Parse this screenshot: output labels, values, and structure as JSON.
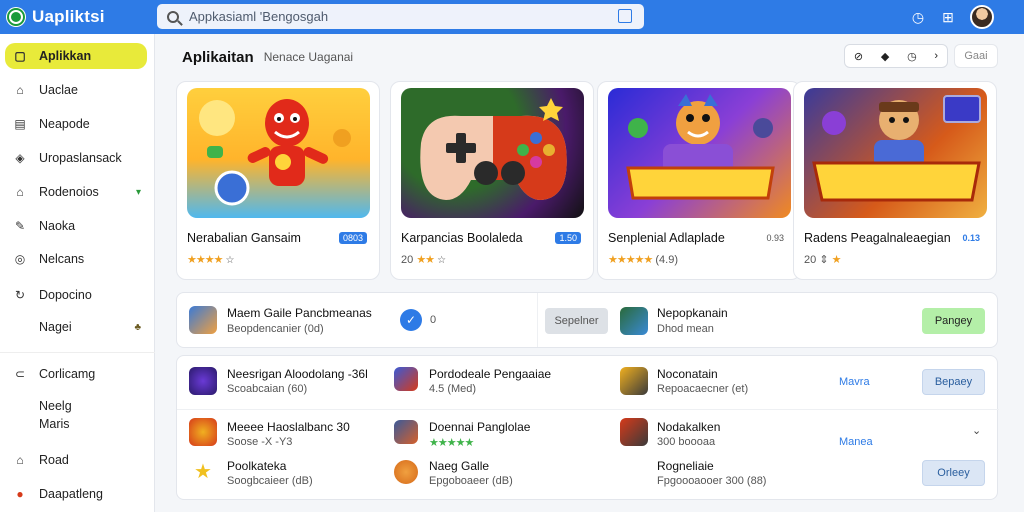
{
  "app": {
    "name": "Uapliktsi",
    "search_placeholder": "Appkasiaml 'Bengosgah"
  },
  "sidebar": {
    "items": [
      {
        "label": "Aplikkan",
        "icon": "grid-icon",
        "trail": ""
      },
      {
        "label": "Uaclae",
        "icon": "home-icon",
        "trail": ""
      },
      {
        "label": "Neapode",
        "icon": "book-icon",
        "trail": ""
      },
      {
        "label": "Uropaslansack",
        "icon": "bookmark-icon",
        "trail": ""
      },
      {
        "label": "Rodenoios",
        "icon": "house-icon",
        "trail": "▾"
      },
      {
        "label": "Naoka",
        "icon": "pen-icon",
        "trail": ""
      },
      {
        "label": "Nelcans",
        "icon": "globe-icon",
        "trail": ""
      },
      {
        "label": "Dopocino",
        "icon": "refresh-icon",
        "trail": ""
      },
      {
        "label": "Nagei",
        "icon": "",
        "trail": "♣"
      },
      {
        "label": "Corlicamg",
        "icon": "cart-icon",
        "trail": ""
      },
      {
        "label": "Neelg",
        "icon": "",
        "trail": ""
      },
      {
        "label": "Maris",
        "icon": "",
        "trail": ""
      },
      {
        "label": "Road",
        "icon": "home-icon",
        "trail": ""
      },
      {
        "label": "Daapatleng",
        "icon": "record-icon",
        "trail": ""
      }
    ]
  },
  "header": {
    "title": "Aplikaitan",
    "subtitle": "Nenace Uaganai",
    "extra": "Gaai"
  },
  "cards": [
    {
      "name": "Nerabalian Gansaim",
      "badge": "0803",
      "meta": "4.7"
    },
    {
      "name": "Karpancias Boolaleda",
      "badge": "1.50",
      "meta": "20"
    },
    {
      "name": "Senplenial Adlaplade",
      "badge": "0.93",
      "meta": "4.9"
    },
    {
      "name": "Radens Peagalnaleaegian",
      "badge": "0.13",
      "meta": "20"
    }
  ],
  "featured": {
    "left": {
      "name": "Maem Gaile Pancbmeanas",
      "meta": "Beopdencanier (0d)",
      "count": "0"
    },
    "middle_button": "Sepelner",
    "right": {
      "name": "Nepopkanain",
      "meta": "Dhod mean"
    },
    "right_button": "Pangey"
  },
  "list_rows": [
    [
      {
        "name": "Neesrigan Aloodolang -36l",
        "meta": "Scoabcaian (60)"
      },
      {
        "name": "Pordodeale Pengaaiae",
        "meta": "4.5 (Med)"
      },
      {
        "name": "Noconatain",
        "meta": "Repoacaecner (et)"
      },
      {
        "link": "Mavra",
        "button": "Bepaey"
      }
    ],
    [
      {
        "name": "Meeee Haoslalbanc 30",
        "meta": "Soose -X -Y3"
      },
      {
        "name": "Doennai Panglolae",
        "meta": "4.6"
      },
      {
        "name": "Nodakalken",
        "meta": "300 boooaa"
      },
      {
        "link": "Manea",
        "button": ""
      }
    ],
    [
      {
        "name": "Poolkateka",
        "meta": "Soogbcaieer (dB)"
      },
      {
        "name": "Naeg Galle",
        "meta": "Epgoboaeer (dB)"
      },
      {
        "name": "Rogneliaie",
        "meta": "Fpgoooaooer 300 (88)"
      },
      {
        "link": "",
        "button": "Orleey"
      }
    ]
  ],
  "colors": {
    "topbar": "#2e7be6",
    "active_nav": "#e8ea3a",
    "accent": "#2e7be6",
    "star": "#f0a020",
    "green_button": "#b4efa8"
  }
}
